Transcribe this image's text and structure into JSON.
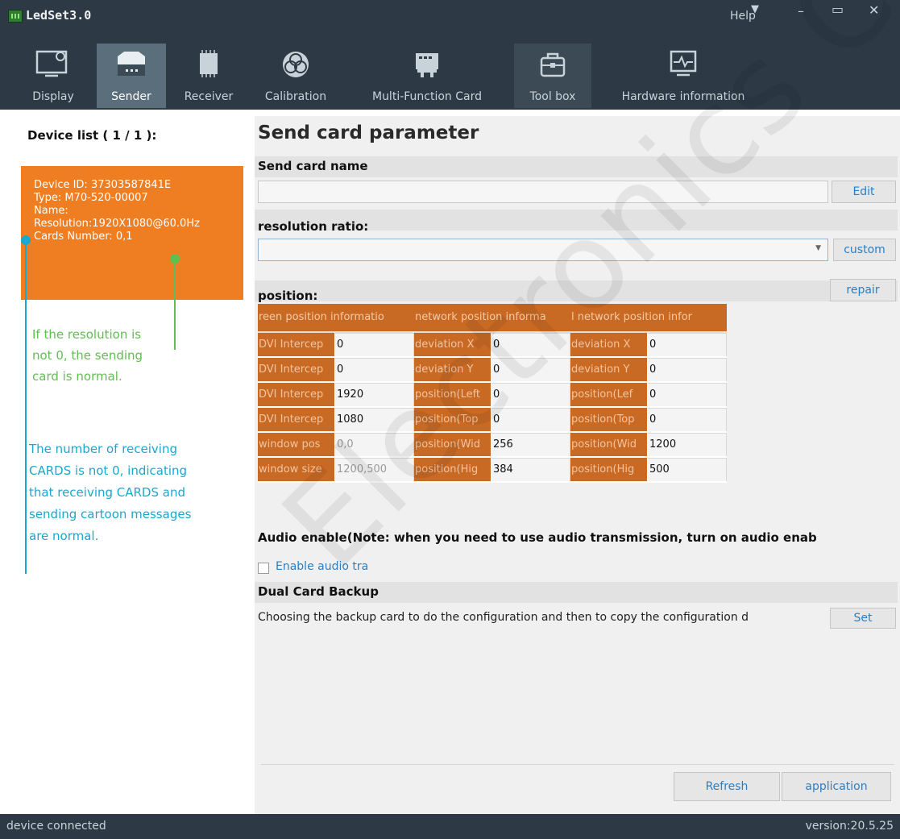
{
  "app": {
    "title": "LedSet3.0"
  },
  "window": {
    "help_label": "Help",
    "min_glyph": "–",
    "max_glyph": "▭",
    "close_glyph": "✕",
    "dropdown_glyph": "▼"
  },
  "toolbar": {
    "items": [
      {
        "label": "Display",
        "icon": "display-settings-icon"
      },
      {
        "label": "Sender",
        "icon": "sender-box-icon",
        "active": true
      },
      {
        "label": "Receiver",
        "icon": "receiver-chip-icon"
      },
      {
        "label": "Calibration",
        "icon": "calibration-rgb-icon"
      },
      {
        "label": "Multi-Function Card",
        "icon": "multifunction-card-icon"
      },
      {
        "label": "Tool box",
        "icon": "toolbox-icon"
      },
      {
        "label": "Hardware information",
        "icon": "hardware-monitor-icon"
      }
    ]
  },
  "sidebar": {
    "title": "Device list ( 1 / 1 ):",
    "device": {
      "id": "Device ID: 37303587841E",
      "type": "Type: M70-520-00007",
      "name": "Name:",
      "resolution": "Resolution:1920X1080@60.0Hz",
      "cards": "Cards Number: 0,1"
    },
    "annotation_green": [
      "If the resolution is",
      "not 0, the sending",
      "card is normal."
    ],
    "annotation_blue": [
      "The number of receiving",
      "CARDS is not 0, indicating",
      "that receiving CARDS and",
      "sending cartoon messages",
      "are normal."
    ]
  },
  "main": {
    "title": "Send card parameter",
    "send_card_name": {
      "label": "Send card name",
      "value": "",
      "edit_label": "Edit"
    },
    "resolution": {
      "label": "resolution ratio:",
      "value": "",
      "custom_label": "custom"
    },
    "position": {
      "label": "position:",
      "repair_label": "repair",
      "columns": [
        {
          "header": "reen position informatio",
          "rows": [
            {
              "key": "DVI Intercep",
              "value": "0"
            },
            {
              "key": "DVI Intercep",
              "value": "0"
            },
            {
              "key": "DVI Intercep",
              "value": "1920"
            },
            {
              "key": "DVI Intercep",
              "value": "1080"
            },
            {
              "key": "window pos",
              "value": "0,0",
              "dim": true
            },
            {
              "key": "window size",
              "value": "1200,500",
              "dim": true
            }
          ]
        },
        {
          "header": "network position informa",
          "rows": [
            {
              "key": "deviation X",
              "value": "0"
            },
            {
              "key": "deviation Y",
              "value": "0"
            },
            {
              "key": "position(Left",
              "value": "0"
            },
            {
              "key": "position(Top",
              "value": "0"
            },
            {
              "key": "position(Wid",
              "value": "256"
            },
            {
              "key": "position(Hig",
              "value": "384"
            }
          ]
        },
        {
          "header": "l network position infor",
          "rows": [
            {
              "key": "deviation X",
              "value": "0"
            },
            {
              "key": "deviation Y",
              "value": "0"
            },
            {
              "key": "position(Lef",
              "value": "0"
            },
            {
              "key": "position(Top",
              "value": "0"
            },
            {
              "key": "position(Wid",
              "value": "1200"
            },
            {
              "key": "position(Hig",
              "value": "500"
            }
          ]
        }
      ]
    },
    "audio": {
      "label": "Audio enable(Note: when you need to use audio transmission, turn on audio enab",
      "checkbox_label": "Enable audio tra",
      "checked": false
    },
    "dual_backup": {
      "label": "Dual Card Backup",
      "description": "Choosing the backup card to do the configuration and then to copy the configuration d",
      "set_label": "Set"
    },
    "refresh_label": "Refresh",
    "apply_label": "application"
  },
  "status": {
    "left": "device connected",
    "right": "version:20.5.25"
  },
  "watermark": "Electronics Co., L",
  "colors": {
    "chrome": "#2d3a45",
    "accent_orange": "#ef7e22",
    "grid_orange": "#c96a24",
    "link_blue": "#2a7fc4",
    "annotation_green": "#5fbf4f",
    "annotation_blue": "#1aa7d0"
  }
}
